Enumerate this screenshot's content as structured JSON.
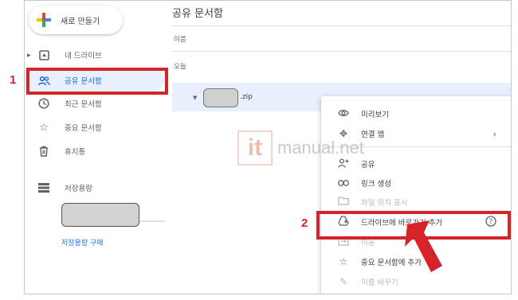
{
  "sidebar": {
    "new_label": "새로 만들기",
    "items": [
      {
        "label": "내 드라이브"
      },
      {
        "label": "공유 문서함"
      },
      {
        "label": "최근 문서함"
      },
      {
        "label": "중요 문서함"
      },
      {
        "label": "휴지통"
      },
      {
        "label": "저장용량"
      }
    ],
    "buy_storage": "저장용량 구매"
  },
  "main": {
    "title": "공유 문서함",
    "column_name": "이름",
    "section": "오늘",
    "file_ext": ".zip"
  },
  "menu": {
    "items": [
      {
        "label": "미리보기"
      },
      {
        "label": "연결 앱"
      },
      {
        "label": "공유"
      },
      {
        "label": "링크 생성"
      },
      {
        "label": "파일 위치 표시"
      },
      {
        "label": "드라이브에 바로가기 추가"
      },
      {
        "label": "이동"
      },
      {
        "label": "중요 문서함에 추가"
      },
      {
        "label": "이름 바꾸기"
      }
    ]
  },
  "annotations": {
    "one": "1",
    "two": "2"
  },
  "watermark": {
    "logo": "it",
    "text": "manual.net"
  },
  "colors": {
    "accent": "#1967d2",
    "highlight": "#d6232a",
    "selected_bg": "#e8f0fe"
  }
}
